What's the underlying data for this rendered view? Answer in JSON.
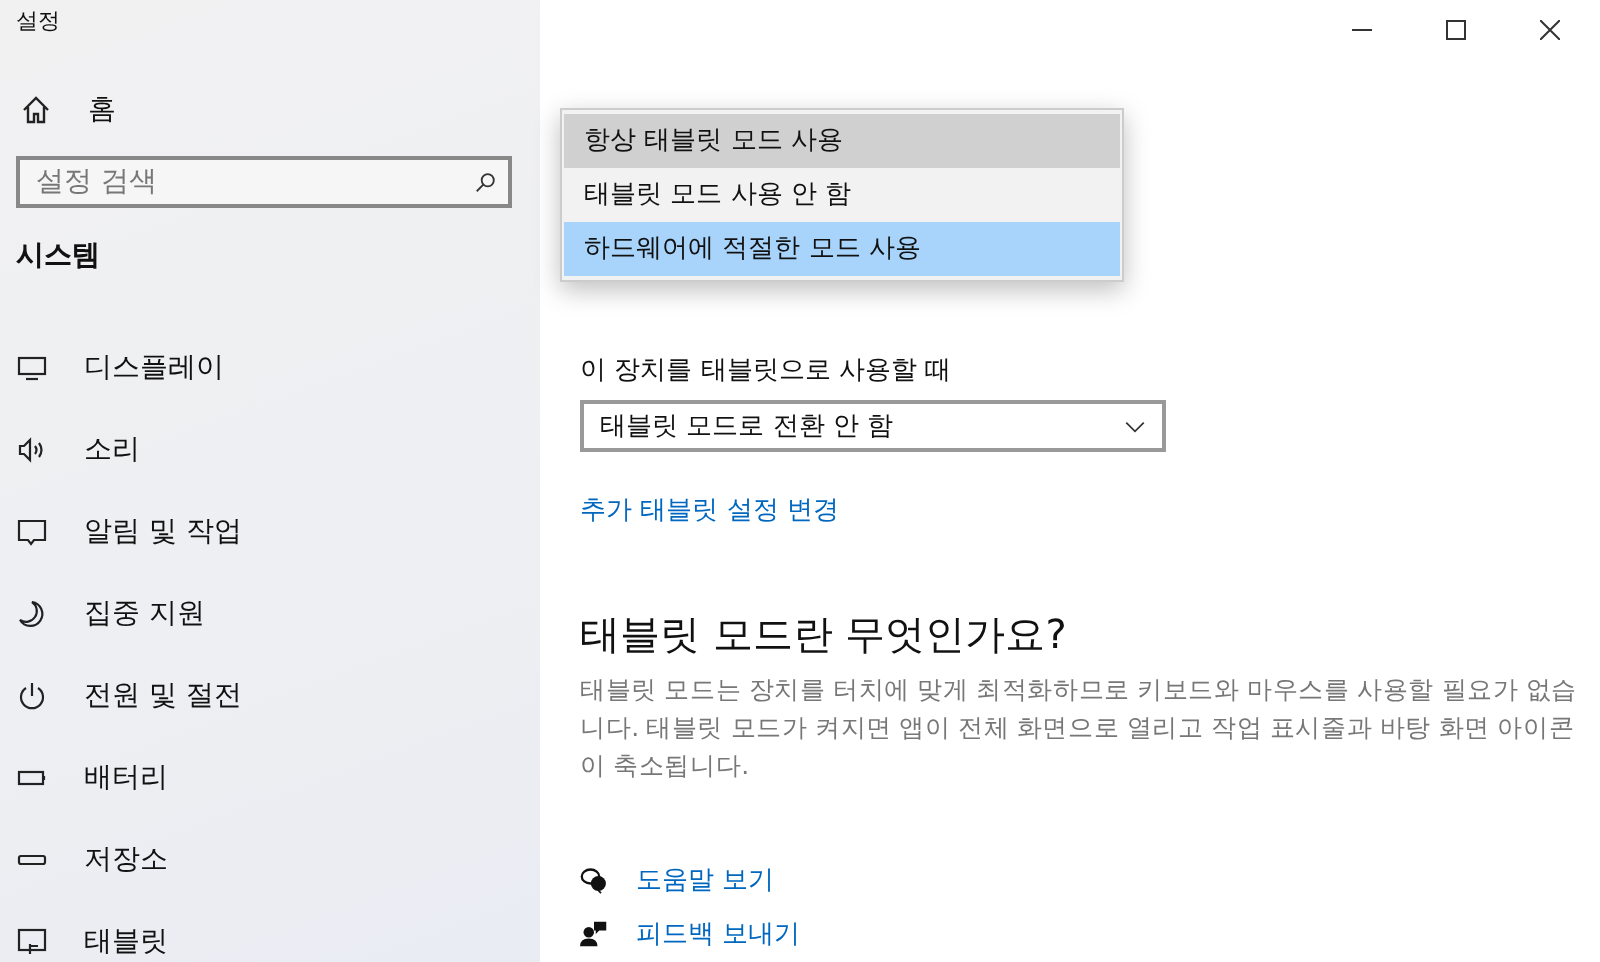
{
  "window": {
    "title": "설정"
  },
  "sidebar": {
    "home": "홈",
    "search": {
      "placeholder": "설정 검색"
    },
    "section": "시스템",
    "items": [
      {
        "label": "디스플레이"
      },
      {
        "label": "소리"
      },
      {
        "label": "알림 및 작업"
      },
      {
        "label": "집중 지원"
      },
      {
        "label": "전원 및 절전"
      },
      {
        "label": "배터리"
      },
      {
        "label": "저장소"
      },
      {
        "label": "태블릿"
      }
    ]
  },
  "page": {
    "dropdown_popup": [
      {
        "label": "항상 태블릿 모드 사용",
        "hovered": true,
        "selected": false
      },
      {
        "label": "태블릿 모드 사용 안 함",
        "hovered": false,
        "selected": false
      },
      {
        "label": "하드웨어에 적절한 모드 사용",
        "hovered": false,
        "selected": true
      }
    ],
    "tablet_use_label": "이 장치를 태블릿으로 사용할 때",
    "tablet_use_value": "태블릿 모드로 전환 안 함",
    "more_link": "추가 태블릿 설정 변경",
    "about_title": "태블릿 모드란 무엇인가요?",
    "about_text": "태블릿 모드는 장치를 터치에 맞게 최적화하므로 키보드와 마우스를 사용할 필요가 없습니다. 태블릿 모드가 켜지면 앱이 전체 화면으로 열리고 작업 표시줄과 바탕 화면 아이콘이 축소됩니다.",
    "help_links": [
      {
        "label": "도움말 보기"
      },
      {
        "label": "피드백 보내기"
      }
    ]
  }
}
